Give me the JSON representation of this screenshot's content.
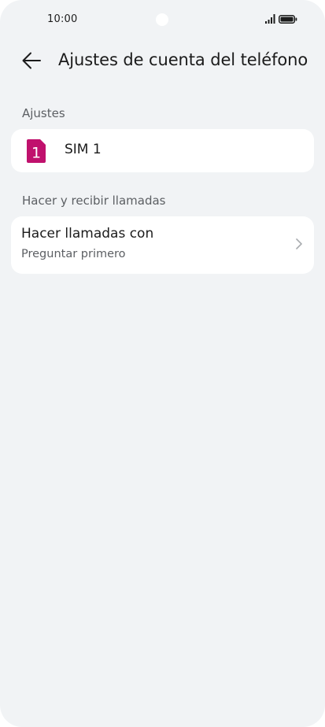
{
  "status_bar": {
    "time": "10:00"
  },
  "header": {
    "back_icon": "arrow-left-icon",
    "title": "Ajustes de cuenta del teléfono"
  },
  "sections": {
    "ajustes": {
      "label": "Ajustes",
      "sim": {
        "icon": "sim-card-icon",
        "icon_number": "1",
        "label": "SIM 1"
      }
    },
    "llamadas": {
      "label": "Hacer y recibir llamadas",
      "item": {
        "title": "Hacer llamadas con",
        "subtitle": "Preguntar primero",
        "icon": "chevron-right-icon"
      }
    }
  },
  "colors": {
    "background": "#f1f3f5",
    "card": "#ffffff",
    "sim_accent": "#c0116d",
    "primary_text": "#1b1b1b",
    "secondary_text": "#5c5f63"
  }
}
